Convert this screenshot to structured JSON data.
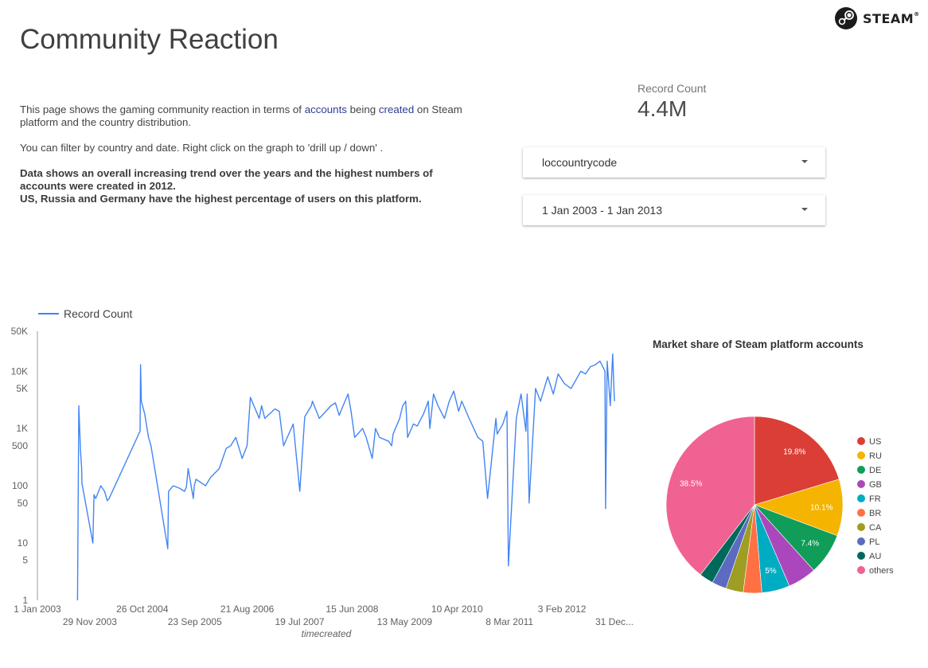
{
  "header": {
    "title": "Community Reaction",
    "brand": "STEAM",
    "brand_mark": "®",
    "logo_icon": "steam-logo-icon"
  },
  "description": {
    "p1_a": "This page shows the gaming community reaction in terms of ",
    "p1_accounts": "accounts",
    "p1_b": " being ",
    "p1_created": "created",
    "p1_c": " on Steam platform and the country distribution.",
    "p2": "You can filter by country and date. Right click on the graph to 'drill up / down' .",
    "p3_line1": "Data shows an overall increasing trend over the years and the highest numbers of accounts were created in 2012.",
    "p3_line2": "US, Russia and Germany have the highest percentage of users on this platform."
  },
  "scorecard": {
    "label": "Record Count",
    "value": "4.4M"
  },
  "filters": {
    "country": {
      "label": "loccountrycode",
      "icon": "dropdown-caret-icon"
    },
    "date": {
      "label": "1 Jan 2003 - 1 Jan 2013",
      "icon": "dropdown-caret-icon"
    }
  },
  "colors": {
    "line": "#4285f4",
    "axis": "#9e9e9e",
    "text": "#616161"
  },
  "chart_data": [
    {
      "type": "line",
      "legend": [
        "Record Count"
      ],
      "legend_position": "top-left",
      "xlabel": "timecreated",
      "ylabel": "",
      "yscale": "log",
      "ylim": [
        1,
        50000
      ],
      "y_ticks": [
        "50K",
        "10K",
        "5K",
        "1K",
        "500",
        "100",
        "50",
        "10",
        "5",
        "1"
      ],
      "x_ticks": [
        "1 Jan 2003",
        "29 Nov 2003",
        "26 Oct 2004",
        "23 Sep 2005",
        "21 Aug 2006",
        "19 Jul 2007",
        "15 Jun 2008",
        "13 May 2009",
        "10 Apr 2010",
        "8 Mar 2011",
        "3 Feb 2012",
        "31 Dec..."
      ],
      "xlim": [
        "2003-01-01",
        "2012-12-31"
      ],
      "grid": false,
      "series": [
        {
          "name": "Record Count",
          "x": [
            "2003-09-12",
            "2003-09-20",
            "2003-10-01",
            "2003-10-08",
            "2003-10-10",
            "2003-12-18",
            "2003-12-25",
            "2004-01-05",
            "2004-02-06",
            "2004-03-01",
            "2004-03-18",
            "2004-03-30",
            "2004-10-12",
            "2004-10-15",
            "2004-10-20",
            "2004-11-10",
            "2004-12-04",
            "2004-12-20",
            "2005-04-05",
            "2005-04-10",
            "2005-05-10",
            "2005-06-20",
            "2005-07-20",
            "2005-08-01",
            "2005-08-12",
            "2005-09-14",
            "2005-09-20",
            "2005-10-01",
            "2005-11-30",
            "2006-01-01",
            "2006-02-25",
            "2006-04-10",
            "2006-05-08",
            "2006-06-10",
            "2006-07-20",
            "2006-08-20",
            "2006-09-10",
            "2006-11-05",
            "2006-11-20",
            "2006-12-10",
            "2007-02-12",
            "2007-03-12",
            "2007-04-08",
            "2007-06-08",
            "2007-07-20",
            "2007-08-20",
            "2007-10-01",
            "2007-10-08",
            "2007-11-20",
            "2008-01-01",
            "2008-02-01",
            "2008-03-01",
            "2008-03-25",
            "2008-04-10",
            "2008-05-20",
            "2008-06-08",
            "2008-07-01",
            "2008-08-20",
            "2008-09-12",
            "2008-10-20",
            "2008-11-10",
            "2008-12-05",
            "2009-02-01",
            "2009-02-20",
            "2009-03-01",
            "2009-04-12",
            "2009-05-01",
            "2009-05-20",
            "2009-06-01",
            "2009-07-08",
            "2009-08-01",
            "2009-09-10",
            "2009-10-10",
            "2009-10-20",
            "2009-11-12",
            "2009-12-10",
            "2010-01-20",
            "2010-02-20",
            "2010-03-20",
            "2010-04-20",
            "2010-05-10",
            "2010-06-25",
            "2010-07-25",
            "2010-08-20",
            "2010-09-20",
            "2010-10-20",
            "2010-12-12",
            "2010-12-20",
            "2011-01-25",
            "2011-02-20",
            "2011-03-01",
            "2011-04-20",
            "2011-05-01",
            "2011-05-20",
            "2011-06-20",
            "2011-06-28",
            "2011-07-10",
            "2011-08-20",
            "2011-09-20",
            "2011-11-05",
            "2011-12-10",
            "2012-01-10",
            "2012-02-20",
            "2012-04-01",
            "2012-06-01",
            "2012-07-01",
            "2012-08-01",
            "2012-09-01",
            "2012-10-01",
            "2012-11-01",
            "2012-11-05",
            "2012-11-15",
            "2012-12-05",
            "2012-12-20",
            "2012-12-31"
          ],
          "values": [
            1,
            2500,
            400,
            200,
            110,
            10,
            70,
            60,
            100,
            80,
            55,
            60,
            900,
            13000,
            3000,
            1800,
            700,
            500,
            8,
            80,
            100,
            90,
            80,
            95,
            200,
            60,
            100,
            130,
            100,
            140,
            200,
            450,
            500,
            700,
            300,
            500,
            3500,
            1500,
            2500,
            1500,
            2200,
            2000,
            500,
            1200,
            80,
            1600,
            2500,
            3000,
            1500,
            2000,
            2500,
            2800,
            1700,
            2200,
            4000,
            2000,
            700,
            1000,
            700,
            300,
            1000,
            700,
            600,
            500,
            800,
            1500,
            2500,
            3000,
            700,
            1200,
            1100,
            1800,
            3000,
            1000,
            4000,
            2500,
            1500,
            3000,
            4500,
            2000,
            3000,
            1500,
            1000,
            700,
            600,
            60,
            1500,
            800,
            1200,
            2000,
            4,
            1500,
            2200,
            4000,
            900,
            4000,
            50,
            5000,
            3000,
            8000,
            4000,
            9000,
            6000,
            5000,
            10000,
            9000,
            12000,
            13000,
            15000,
            10000,
            40,
            15000,
            2500,
            20000,
            3000
          ]
        }
      ]
    },
    {
      "type": "pie",
      "title": "Market share of Steam platform accounts",
      "legend": [
        "US",
        "RU",
        "DE",
        "GB",
        "FR",
        "BR",
        "CA",
        "PL",
        "AU",
        "others"
      ],
      "legend_position": "right",
      "values": [
        19.8,
        10.1,
        7.4,
        5.1,
        5.0,
        3.3,
        3.1,
        2.6,
        2.5,
        38.5
      ],
      "labels": [
        "19.8%",
        "10.1%",
        "7.4%",
        "",
        "5%",
        "",
        "",
        "",
        "",
        "38.5%"
      ],
      "colors": [
        "#db3e36",
        "#f4b400",
        "#0f9d58",
        "#ab47bc",
        "#00acc1",
        "#ff7043",
        "#9e9d24",
        "#5c6bc0",
        "#00695c",
        "#f06292"
      ]
    }
  ]
}
